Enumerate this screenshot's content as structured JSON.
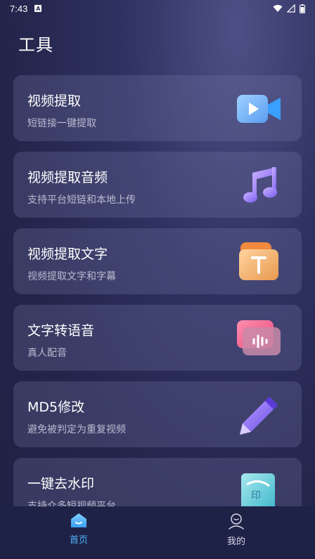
{
  "status": {
    "time": "7:43",
    "badge": "A"
  },
  "page": {
    "title": "工具"
  },
  "tools": [
    {
      "title": "视频提取",
      "subtitle": "短链接一键提取",
      "icon": "video-camera-icon"
    },
    {
      "title": "视频提取音频",
      "subtitle": "支持平台短链和本地上传",
      "icon": "music-note-icon"
    },
    {
      "title": "视频提取文字",
      "subtitle": "视频提取文字和字幕",
      "icon": "text-t-icon"
    },
    {
      "title": "文字转语音",
      "subtitle": "真人配音",
      "icon": "sound-wave-icon"
    },
    {
      "title": "MD5修改",
      "subtitle": "避免被判定为重复视频",
      "icon": "pen-icon"
    },
    {
      "title": "一键去水印",
      "subtitle": "支持众多短视频平台",
      "icon": "stamp-icon"
    }
  ],
  "nav": {
    "home_label": "首页",
    "mine_label": "我的",
    "active_color": "#4fb6ff"
  }
}
